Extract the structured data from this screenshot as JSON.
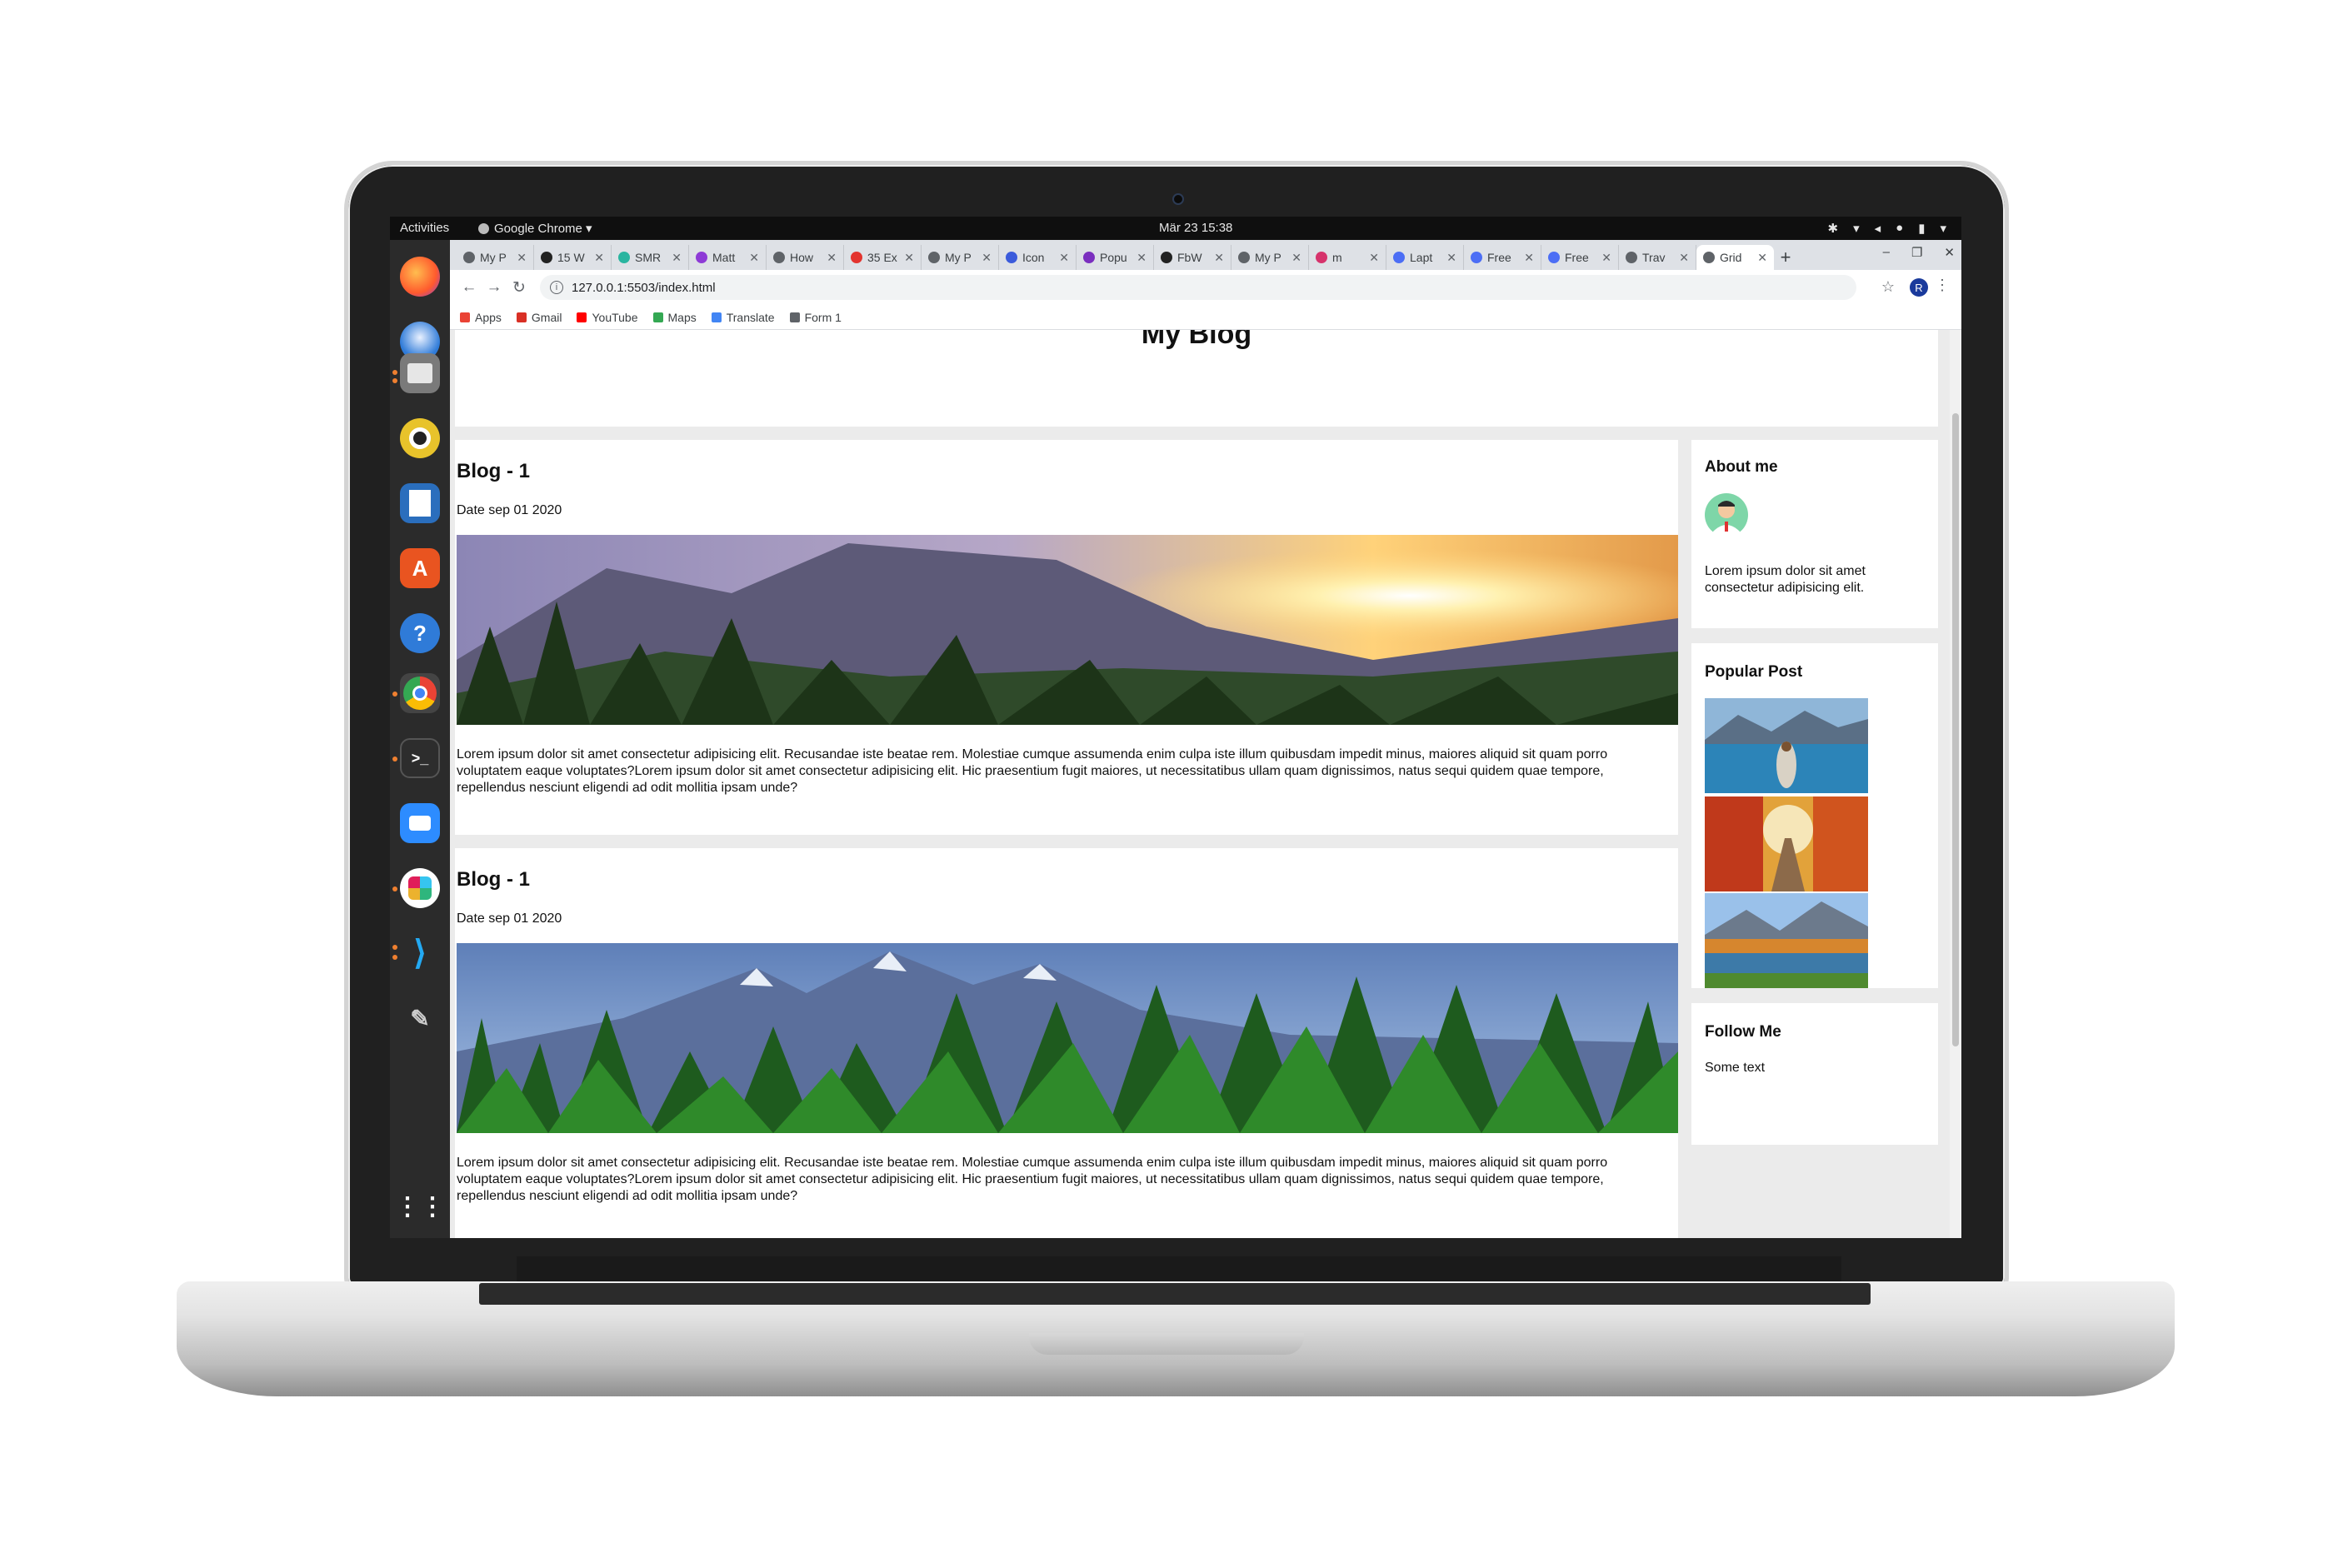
{
  "desktop": {
    "activities": "Activities",
    "app_name": "Google Chrome ▾",
    "clock": "Mär 23  15:38"
  },
  "browser": {
    "tabs": [
      {
        "label": "My P",
        "color": "#5f6368"
      },
      {
        "label": "15 W",
        "color": "#222222"
      },
      {
        "label": "SMR",
        "color": "#2ab5a0"
      },
      {
        "label": "Matt",
        "color": "#8e3bd6"
      },
      {
        "label": "How",
        "color": "#5f6368"
      },
      {
        "label": "35 Ex",
        "color": "#e3342f"
      },
      {
        "label": "My P",
        "color": "#5f6368"
      },
      {
        "label": "Icon",
        "color": "#3b5bdb"
      },
      {
        "label": "Popu",
        "color": "#7b2fbf"
      },
      {
        "label": "FbW",
        "color": "#222222"
      },
      {
        "label": "My P",
        "color": "#5f6368"
      },
      {
        "label": "m",
        "color": "#d6336c"
      },
      {
        "label": "Lapt",
        "color": "#4c6ef5"
      },
      {
        "label": "Free",
        "color": "#4c6ef5"
      },
      {
        "label": "Free",
        "color": "#4c6ef5"
      },
      {
        "label": "Trav",
        "color": "#5f6368"
      },
      {
        "label": "Grid",
        "color": "#5f6368"
      }
    ],
    "url": "127.0.0.1:5503/index.html",
    "avatar_letter": "R",
    "bookmarks": [
      {
        "label": "Apps",
        "color": "#ea4335"
      },
      {
        "label": "Gmail",
        "color": "#d93025"
      },
      {
        "label": "YouTube",
        "color": "#ff0000"
      },
      {
        "label": "Maps",
        "color": "#34a853"
      },
      {
        "label": "Translate",
        "color": "#4285f4"
      },
      {
        "label": "Form 1",
        "color": "#5f6368"
      }
    ]
  },
  "page": {
    "header_title": "My Blog",
    "posts": [
      {
        "title": "Blog - 1",
        "date": "Date sep 01 2020",
        "body": "Lorem ipsum dolor sit amet consectetur adipisicing elit. Recusandae iste beatae rem. Molestiae cumque assumenda enim culpa iste illum quibusdam impedit minus, maiores aliquid sit quam porro voluptatem eaque voluptates?Lorem ipsum dolor sit amet consectetur adipisicing elit. Hic praesentium fugit maiores, ut necessitatibus ullam quam dignissimos, natus sequi quidem quae tempore, repellendus nesciunt eligendi ad odit mollitia ipsam unde?"
      },
      {
        "title": "Blog - 1",
        "date": "Date sep 01 2020",
        "body": "Lorem ipsum dolor sit amet consectetur adipisicing elit. Recusandae iste beatae rem. Molestiae cumque assumenda enim culpa iste illum quibusdam impedit minus, maiores aliquid sit quam porro voluptatem eaque voluptates?Lorem ipsum dolor sit amet consectetur adipisicing elit. Hic praesentium fugit maiores, ut necessitatibus ullam quam dignissimos, natus sequi quidem quae tempore, repellendus nesciunt eligendi ad odit mollitia ipsam unde?"
      }
    ],
    "sidebar": {
      "about_title": "About me",
      "about_text": "Lorem ipsum dolor sit amet consectetur adipisicing elit.",
      "popular_title": "Popular Post",
      "follow_title": "Follow Me",
      "follow_text": "Some text"
    }
  }
}
